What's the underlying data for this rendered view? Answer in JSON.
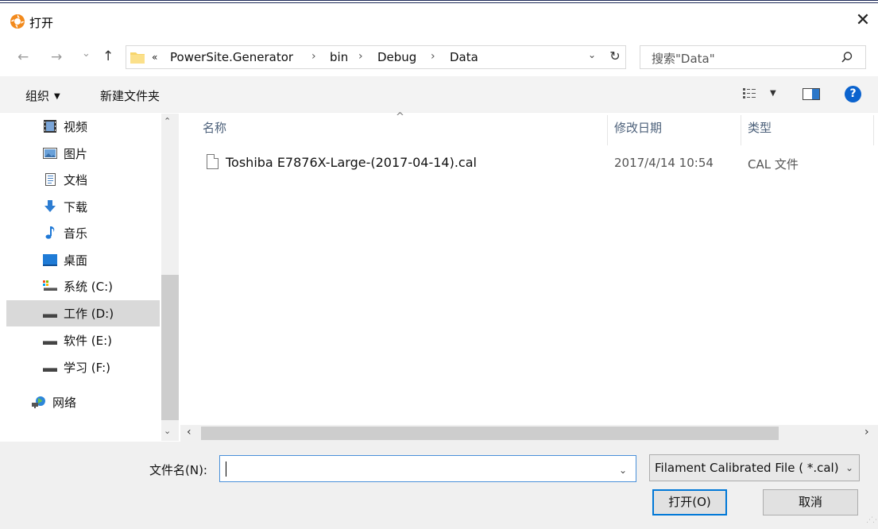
{
  "window": {
    "title": "打开",
    "close_glyph": "✕"
  },
  "nav": {
    "back": "←",
    "forward": "→",
    "recent": "⌄",
    "up": "↑"
  },
  "address": {
    "overflow": "«",
    "crumbs": [
      "PowerSite.Generator",
      "bin",
      "Debug",
      "Data"
    ],
    "separator": "›",
    "dropdown": "⌄",
    "refresh": "↻"
  },
  "search": {
    "placeholder": "搜索\"Data\""
  },
  "toolbar": {
    "organize": "组织",
    "organize_arrow": "▼",
    "new_folder": "新建文件夹",
    "views_arrow": "▼",
    "help": "?"
  },
  "navpane": {
    "items": [
      {
        "label": "视频",
        "icon": "video-icon"
      },
      {
        "label": "图片",
        "icon": "pictures-icon"
      },
      {
        "label": "文档",
        "icon": "documents-icon"
      },
      {
        "label": "下载",
        "icon": "download-icon"
      },
      {
        "label": "音乐",
        "icon": "music-icon"
      },
      {
        "label": "桌面",
        "icon": "desktop-icon"
      },
      {
        "label": "系统 (C:)",
        "icon": "system-drive-icon"
      },
      {
        "label": "工作 (D:)",
        "icon": "drive-icon",
        "selected": true
      },
      {
        "label": "软件 (E:)",
        "icon": "drive-icon"
      },
      {
        "label": "学习 (F:)",
        "icon": "drive-icon"
      },
      {
        "label": "网络",
        "icon": "network-icon"
      }
    ]
  },
  "columns": {
    "name": "名称",
    "modified": "修改日期",
    "type": "类型",
    "sort_indicator": "^"
  },
  "files": [
    {
      "name": "Toshiba E7876X-Large-(2017-04-14).cal",
      "modified": "2017/4/14 10:54",
      "type": "CAL 文件"
    }
  ],
  "scroll": {
    "up": "⌃",
    "down": "⌄",
    "left": "‹",
    "right": "›"
  },
  "bottom": {
    "filename_label": "文件名(N):",
    "filename_value": "",
    "filename_dropdown": "⌄",
    "filetype": "Filament Calibrated File ( *.cal)",
    "filetype_arrow": "⌄",
    "open": "打开(O)",
    "cancel": "取消"
  },
  "colors": {
    "accent": "#0078d7",
    "help": "#0b63ce",
    "selected_bg": "#d9d9d9",
    "header_text": "#4c607a"
  }
}
